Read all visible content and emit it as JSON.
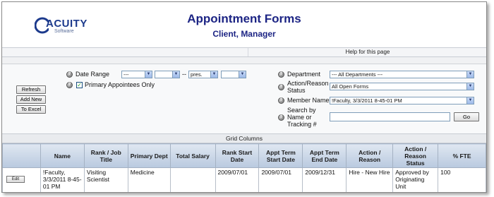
{
  "logo": {
    "name": "ACUITY",
    "sub": "Software"
  },
  "header": {
    "title": "Appointment Forms",
    "subtitle": "Client, Manager"
  },
  "help": {
    "label": "Help for this page"
  },
  "buttons": {
    "refresh": "Refresh",
    "add_new": "Add New",
    "to_excel": "To Excel",
    "go": "Go",
    "edit": "Edit"
  },
  "filters": {
    "date_range_label": "Date Range",
    "date_from_1": "---",
    "date_from_2": "",
    "date_sep": "--",
    "date_to_1": "pres.",
    "date_to_2": "",
    "primary_only_label": "Primary Appointees Only",
    "primary_only_checked": true,
    "department_label": "Department",
    "department_value": "--- All Departments ---",
    "action_reason_label": "Action/Reason Status",
    "action_reason_value": "All Open Forms",
    "member_name_label": "Member Name",
    "member_name_value": "!Faculty, 3/3/2011 8-45-01 PM",
    "search_label": "Search by Name or Tracking #",
    "search_value": ""
  },
  "grid": {
    "caption": "Grid Columns",
    "columns": [
      "",
      "Name",
      "Rank / Job Title",
      "Primary Dept",
      "Total Salary",
      "Rank Start Date",
      "Appt Term Start Date",
      "Appt Term End Date",
      "Action / Reason",
      "Action / Reason Status",
      "% FTE"
    ],
    "rows": [
      {
        "name": "!Faculty, 3/3/2011 8-45-01 PM",
        "rank_job_title": "Visiting Scientist",
        "primary_dept": "Medicine",
        "total_salary": "",
        "rank_start_date": "2009/07/01",
        "appt_term_start_date": "2009/07/01",
        "appt_term_end_date": "2009/12/31",
        "action_reason": "Hire - New Hire",
        "action_reason_status": "Approved by Originating Unit",
        "pct_fte": "100"
      }
    ]
  },
  "colors": {
    "title": "#1c2484",
    "header_grad_top": "#dfe7f1",
    "header_grad_bottom": "#b9c9df",
    "check": "#21a121"
  }
}
